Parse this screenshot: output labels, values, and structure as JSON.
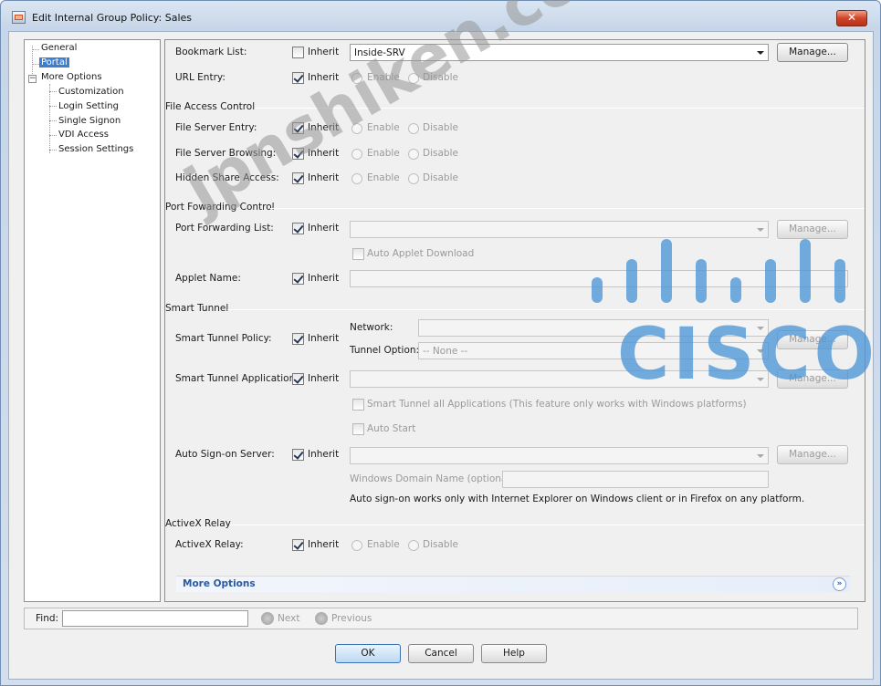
{
  "window": {
    "title": "Edit Internal Group Policy: Sales",
    "close_glyph": "✕"
  },
  "tree": {
    "items": [
      {
        "label": "General"
      },
      {
        "label": "Portal"
      },
      {
        "label": "More Options"
      },
      {
        "label": "Customization"
      },
      {
        "label": "Login Setting"
      },
      {
        "label": "Single Signon"
      },
      {
        "label": "VDI Access"
      },
      {
        "label": "Session Settings"
      }
    ],
    "expander": "−"
  },
  "common": {
    "inherit": "Inherit",
    "enable": "Enable",
    "disable": "Disable",
    "manage": "Manage..."
  },
  "bookmark": {
    "label": "Bookmark List:",
    "value": "Inside-SRV"
  },
  "url_entry": {
    "label": "URL Entry:"
  },
  "file_access": {
    "title": "File Access Control",
    "server_entry": "File Server Entry:",
    "server_browsing": "File Server Browsing:",
    "hidden_share": "Hidden Share Access:"
  },
  "port_forwarding": {
    "title": "Port Fowarding Control",
    "list_label": "Port Forwarding List:",
    "auto_applet": "Auto Applet Download",
    "applet_name": "Applet Name:"
  },
  "smart_tunnel": {
    "title": "Smart Tunnel",
    "policy_label": "Smart Tunnel Policy:",
    "network_label": "Network:",
    "tunnel_option_label": "Tunnel Option:",
    "tunnel_option_value": "-- None --",
    "application_label": "Smart Tunnel Application:",
    "all_apps": "Smart Tunnel all Applications (This feature only works with Windows platforms)",
    "auto_start": "Auto Start",
    "auto_signon_label": "Auto Sign-on Server:",
    "windows_domain_label": "Windows Domain Name (optional):",
    "note": "Auto sign-on works only with Internet Explorer on Windows client or in Firefox on any platform."
  },
  "activex": {
    "title": "ActiveX Relay",
    "label": "ActiveX Relay:"
  },
  "more_options": {
    "label": "More Options",
    "caret": "»"
  },
  "find": {
    "label": "Find:",
    "next": "Next",
    "previous": "Previous"
  },
  "buttons": {
    "ok": "OK",
    "cancel": "Cancel",
    "help": "Help"
  },
  "watermark": {
    "text": "jpnshiken.com",
    "logo_text": "CISCO"
  },
  "colors": {
    "selection": "#3c7fd1",
    "link": "#2a5aa0",
    "logo": "#4b96d6"
  }
}
